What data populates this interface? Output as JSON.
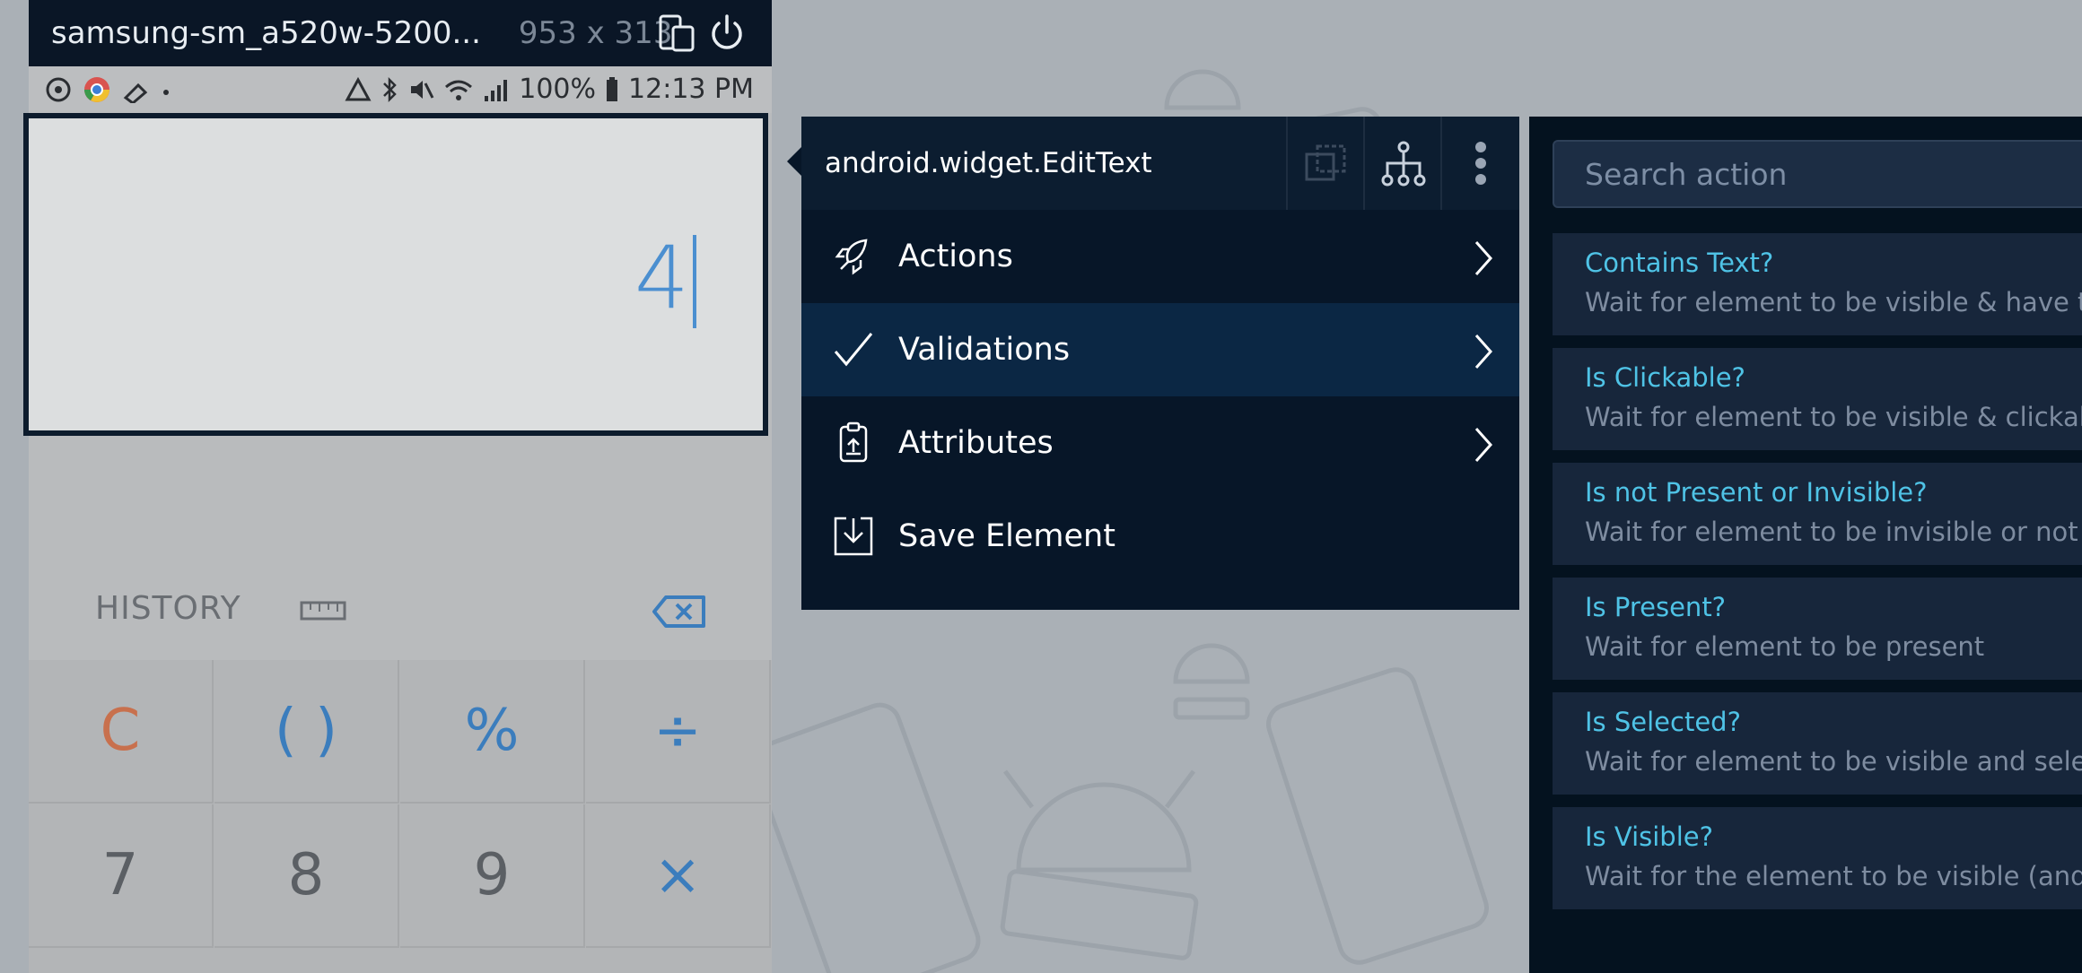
{
  "device": {
    "name": "samsung-sm_a520w-5200...",
    "resolution": "953 x 313"
  },
  "statusbar": {
    "battery": "100%",
    "time": "12:13 PM"
  },
  "app": {
    "edit_value": "4",
    "history_label": "HISTORY",
    "keys": [
      [
        "C",
        "( )",
        "%",
        "÷"
      ],
      [
        "7",
        "8",
        "9",
        "×"
      ]
    ]
  },
  "popup": {
    "title": "android.widget.EditText",
    "menu": [
      {
        "label": "Actions",
        "icon": "rocket-icon",
        "active": false
      },
      {
        "label": "Validations",
        "icon": "checkmark-icon",
        "active": true
      },
      {
        "label": "Attributes",
        "icon": "clipboard-icon",
        "active": false
      },
      {
        "label": "Save Element",
        "icon": "save-icon",
        "active": false
      }
    ]
  },
  "validations": {
    "search_placeholder": "Search action",
    "items": [
      {
        "title": "Contains Text?",
        "desc": "Wait for element to be visible & have the"
      },
      {
        "title": "Is Clickable?",
        "desc": "Wait for element to be visible & clickable"
      },
      {
        "title": "Is not Present or Invisible?",
        "desc": "Wait for element to be invisible or not to"
      },
      {
        "title": "Is Present?",
        "desc": "Wait for element to be present"
      },
      {
        "title": "Is Selected?",
        "desc": "Wait for element to be visible and select"
      },
      {
        "title": "Is Visible?",
        "desc": "Wait for the element to be visible (and h"
      }
    ]
  },
  "colors": {
    "header": "#0a1626",
    "popup": "#071628",
    "active_item": "#0b2744",
    "accent_text": "#4fc3e6",
    "caret": "#4b8fd0"
  }
}
